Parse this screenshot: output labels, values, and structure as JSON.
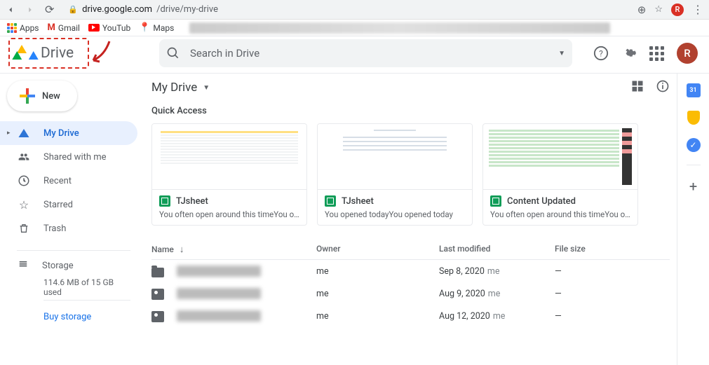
{
  "browser": {
    "url_host": "drive.google.com",
    "url_path": "/drive/my-drive",
    "avatar_letter": "R"
  },
  "bookmarks": {
    "apps": "Apps",
    "gmail": "Gmail",
    "youtube": "YouTub",
    "maps": "Maps"
  },
  "logo": {
    "text": "Drive"
  },
  "search": {
    "placeholder": "Search in Drive"
  },
  "header": {
    "avatar_letter": "R"
  },
  "new_button": {
    "label": "New"
  },
  "sidebar": {
    "items": [
      {
        "label": "My Drive"
      },
      {
        "label": "Shared with me"
      },
      {
        "label": "Recent"
      },
      {
        "label": "Starred"
      },
      {
        "label": "Trash"
      }
    ],
    "storage_label": "Storage",
    "storage_used": "114.6 MB of 15 GB used",
    "buy": "Buy storage"
  },
  "crumb": {
    "title": "My Drive"
  },
  "quick_access": {
    "heading": "Quick Access",
    "cards": [
      {
        "title": "TJsheet",
        "sub": "You often open around this timeYou often…"
      },
      {
        "title": "TJsheet",
        "sub": "You opened todayYou opened today"
      },
      {
        "title": "Content Updated",
        "sub": "You often open around this timeYou often…"
      }
    ]
  },
  "table": {
    "headers": {
      "name": "Name",
      "owner": "Owner",
      "modified": "Last modified",
      "size": "File size"
    },
    "rows": [
      {
        "owner": "me",
        "modified": "Sep 8, 2020",
        "mod_by": "me",
        "size": "—"
      },
      {
        "owner": "me",
        "modified": "Aug 9, 2020",
        "mod_by": "me",
        "size": "—"
      },
      {
        "owner": "me",
        "modified": "Aug 12, 2020",
        "mod_by": "me",
        "size": "—"
      }
    ]
  },
  "rightbar": {
    "cal_day": "31"
  }
}
